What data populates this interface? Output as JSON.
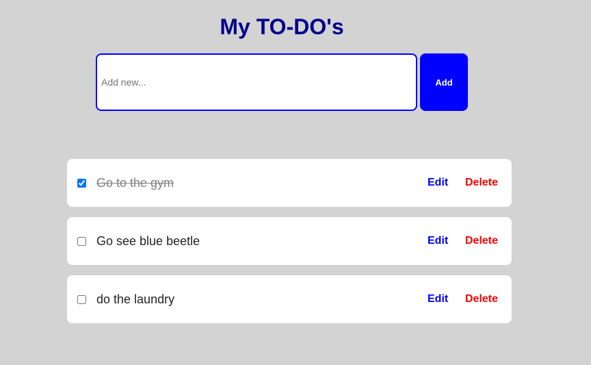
{
  "title": "My TO-DO's",
  "input": {
    "placeholder": "Add new...",
    "value": ""
  },
  "add_label": "Add",
  "todos": [
    {
      "text": "Go to the gym",
      "done": true,
      "edit": "Edit",
      "delete": "Delete"
    },
    {
      "text": "Go see blue beetle",
      "done": false,
      "edit": "Edit",
      "delete": "Delete"
    },
    {
      "text": "do the laundry",
      "done": false,
      "edit": "Edit",
      "delete": "Delete"
    }
  ],
  "colors": {
    "title": "#00008b",
    "accent": "#0000ff",
    "delete": "#ff0000",
    "background": "#d3d3d3"
  }
}
